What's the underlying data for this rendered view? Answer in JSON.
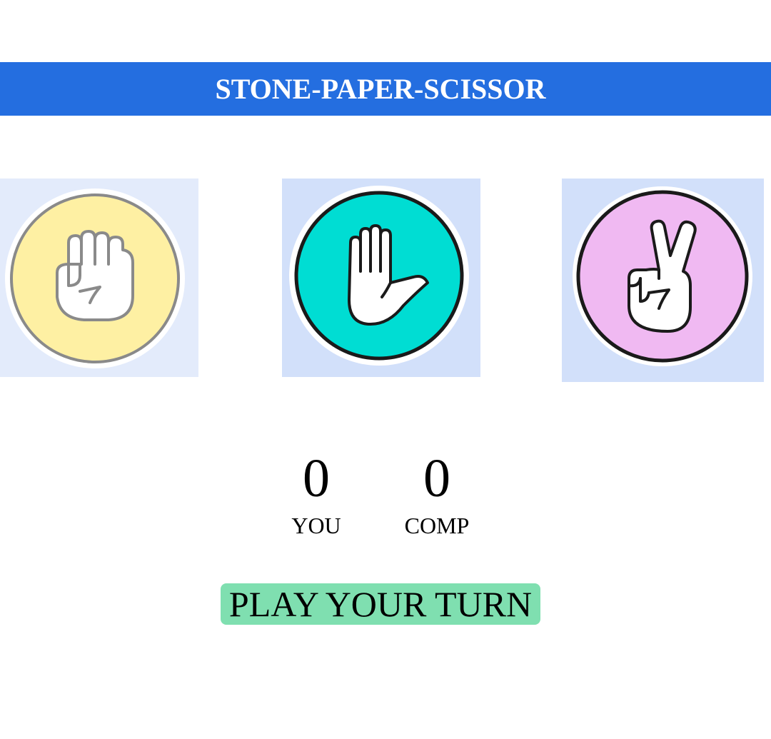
{
  "header": {
    "title": "STONE-PAPER-SCISSOR"
  },
  "choices": [
    {
      "id": "stone",
      "icon": "fist-icon",
      "circle_color": "#fef0a3",
      "ring_color": "#8a8a8a",
      "bg_color": "#e3ebfb"
    },
    {
      "id": "paper",
      "icon": "open-hand-icon",
      "circle_color": "#00ddd3",
      "ring_color": "#1a1a1a",
      "bg_color": "#d2e0fa"
    },
    {
      "id": "scissor",
      "icon": "peace-sign-icon",
      "circle_color": "#f0b9f2",
      "ring_color": "#1a1a1a",
      "bg_color": "#d2e0fa"
    }
  ],
  "scoreboard": {
    "you": {
      "score": "0",
      "label": "YOU"
    },
    "comp": {
      "score": "0",
      "label": "COMP"
    }
  },
  "message": {
    "text": "PLAY YOUR TURN",
    "bg_color": "#7fdfb0"
  },
  "colors": {
    "header_bg": "#246ee0",
    "header_text": "#ffffff"
  }
}
